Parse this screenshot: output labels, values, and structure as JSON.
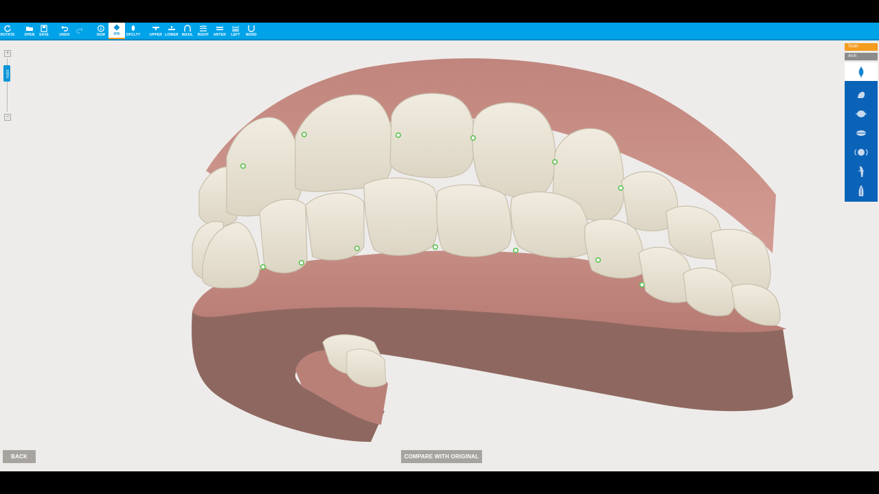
{
  "toolbar": {
    "buttons": [
      {
        "label": "ROTATE",
        "icon": "rotate-icon"
      },
      {
        "label": "OPEN",
        "icon": "folder-icon"
      },
      {
        "label": "SAVE",
        "icon": "save-icon"
      },
      {
        "label": "UNDO",
        "icon": "undo-icon"
      },
      {
        "label": "",
        "icon": "redo-icon"
      },
      {
        "label": "NUM",
        "icon": "info-icon"
      },
      {
        "label": "IPR",
        "icon": "ipr-diamond-icon"
      },
      {
        "label": "OPCLTY",
        "icon": "opacity-icon"
      },
      {
        "label": "UPPER",
        "icon": "upper-view-icon"
      },
      {
        "label": "LOWER",
        "icon": "lower-view-icon"
      },
      {
        "label": "MAXIL",
        "icon": "maxilla-icon"
      },
      {
        "label": "RIGHT",
        "icon": "right-view-icon"
      },
      {
        "label": "ANTER",
        "icon": "anterior-view-icon"
      },
      {
        "label": "LEFT",
        "icon": "left-view-icon"
      },
      {
        "label": "MAND",
        "icon": "mandible-icon"
      }
    ],
    "active_index": 6
  },
  "zoom": {
    "plus": "+",
    "minus": "−",
    "level": "100%"
  },
  "right_panel": {
    "tab_tooth": "Tooth",
    "tab_arch": "Arch",
    "tools": [
      "tooth-crown-icon",
      "tilt-tooth-icon",
      "tooth-disc-icon",
      "rotate-tooth-icon",
      "bracket-tooth-icon",
      "root-tooth-icon",
      "root-angle-icon"
    ]
  },
  "bottom": {
    "back_label": "BACK",
    "compare_label": "COMPARE WITH ORIGINAL"
  },
  "colors": {
    "toolbar": "#00a2e8",
    "accent": "#f39c1f",
    "panel": "#0b63b8",
    "gum": "#c98f86",
    "tooth": "#e7e2d4",
    "ipr_marker": "#5cc04f"
  }
}
